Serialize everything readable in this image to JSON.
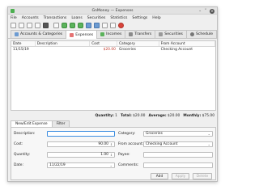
{
  "window": {
    "title": "GnMoney — Expenses"
  },
  "menu": [
    "File",
    "Accounts",
    "Transactions",
    "Loans",
    "Securities",
    "Statistics",
    "Settings",
    "Help"
  ],
  "tabs": [
    {
      "label": "Accounts & Categories",
      "color": "#6c9bd2"
    },
    {
      "label": "Expenses",
      "color": "#e57373",
      "active": true
    },
    {
      "label": "Incomes",
      "color": "#5bb35b"
    },
    {
      "label": "Transfers",
      "color": "#8a8a8a"
    },
    {
      "label": "Securities",
      "color": "#999999"
    },
    {
      "label": "Schedule",
      "color": "#777777"
    }
  ],
  "table": {
    "headers": {
      "date": "Date",
      "description": "Description",
      "cost": "Cost",
      "category": "Category",
      "from": "From Account"
    },
    "rows": [
      {
        "date": "11/15/19",
        "description": "",
        "cost": "$20.00",
        "category": "Groceries",
        "from": "Checking Account"
      }
    ]
  },
  "summary": {
    "quantity_label": "Quantity:",
    "quantity": "1",
    "total_label": "Total:",
    "total": "$20.00",
    "average_label": "Average:",
    "average": "$20.00",
    "monthly_label": "Monthly:",
    "monthly": "$75.00"
  },
  "subtabs": [
    "New/Edit Expense",
    "Filter"
  ],
  "form": {
    "description_label": "Description:",
    "description": "",
    "cost_label": "Cost:",
    "cost": "90.00",
    "quantity_label": "Quantity:",
    "quantity": "1.00",
    "date_label": "Date:",
    "date": "11/22/19",
    "category_label": "Category:",
    "category": "Groceries",
    "from_label": "From account:",
    "from": "Checking Account",
    "payee_label": "Payee:",
    "payee": "",
    "comments_label": "Comments:",
    "comments": ""
  },
  "buttons": {
    "add": "Add",
    "apply": "Apply",
    "delete": "Delete"
  }
}
